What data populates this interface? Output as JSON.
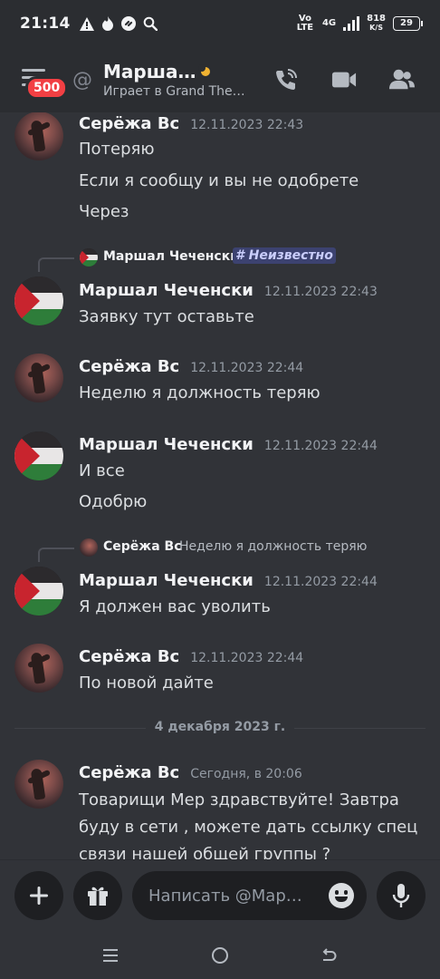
{
  "status_bar": {
    "time": "21:14",
    "network_labels": [
      "Vo LTE",
      "4G"
    ],
    "net_speed": "818",
    "net_speed_unit": "K/S",
    "battery": "29"
  },
  "header": {
    "menu_badge": "500",
    "title": "Марша…",
    "subtitle": "Играет в Grand The…",
    "accent_color": "#f0b232"
  },
  "messages": [
    {
      "author": "Серёжа Вс",
      "timestamp": "12.11.2023 22:43",
      "lines": [
        "Потеряю",
        "Если я сообщу и вы не одобрете",
        "Через"
      ]
    },
    {
      "reply_to_author": "Маршал Чеченски",
      "reply_to_tag": "# Неизвестно",
      "author": "Маршал Чеченски",
      "timestamp": "12.11.2023 22:43",
      "lines": [
        "Заявку тут оставьте"
      ]
    },
    {
      "author": "Серёжа Вс",
      "timestamp": "12.11.2023 22:44",
      "lines": [
        "Неделю я должность теряю"
      ]
    },
    {
      "author": "Маршал Чеченски",
      "timestamp": "12.11.2023 22:44",
      "lines": [
        "И все",
        "Одобрю"
      ]
    },
    {
      "reply_to_author": "Серёжа Вс",
      "reply_to_text": "Неделю я должность теряю",
      "author": "Маршал Чеченски",
      "timestamp": "12.11.2023 22:44",
      "lines": [
        "Я должен вас уволить"
      ]
    },
    {
      "author": "Серёжа Вс",
      "timestamp": "12.11.2023 22:44",
      "lines": [
        "По новой дайте"
      ]
    },
    {
      "author": "Серёжа Вс",
      "timestamp": "Сегодня, в 20:06",
      "lines": [
        "Товарищи Мер здравствуйте! Завтра",
        "буду в сети , можете дать ссылку спец",
        "связи нашей общей группы ?"
      ]
    }
  ],
  "date_divider": "4 декабря 2023 г.",
  "composer": {
    "placeholder": "Написать @Мар…"
  }
}
